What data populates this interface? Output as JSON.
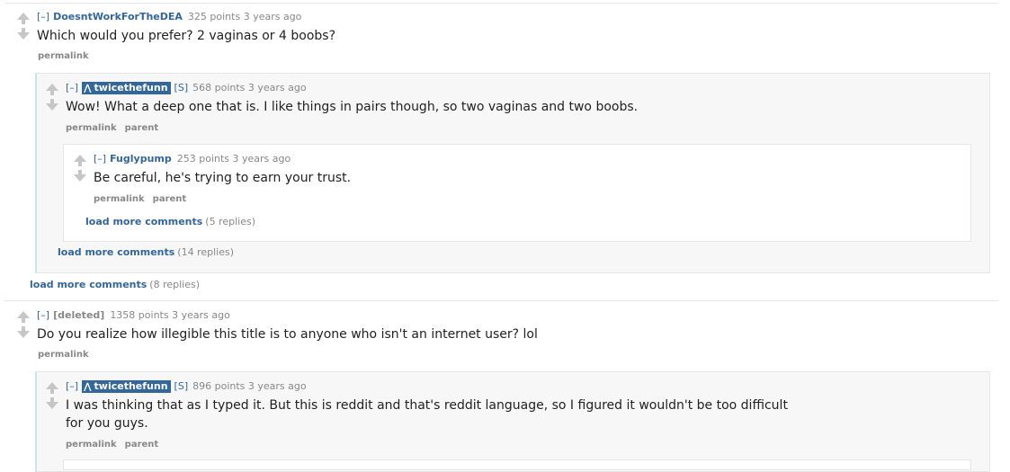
{
  "top_comment_1": {
    "toggle": "[–]",
    "author": "DoesntWorkForTheDEA",
    "meta": "325 points 3 years ago",
    "body": "Which would you prefer? 2 vaginas or 4 boobs?",
    "permalink": "permalink"
  },
  "reply_1": {
    "toggle": "[–]",
    "author": "twicethefunn",
    "submitter": "[S]",
    "meta": "568 points 3 years ago",
    "body": "Wow! What a deep one that is. I like things in pairs though, so two vaginas and two boobs.",
    "permalink": "permalink",
    "parent": "parent"
  },
  "reply_1_1": {
    "toggle": "[–]",
    "author": "Fuglypump",
    "meta": "253 points 3 years ago",
    "body": "Be careful, he's trying to earn your trust.",
    "permalink": "permalink",
    "parent": "parent",
    "more_label": "load more comments",
    "more_count": "(5 replies)"
  },
  "reply_1_more": {
    "label": "load more comments",
    "count": "(14 replies)"
  },
  "top_1_more": {
    "label": "load more comments",
    "count": "(8 replies)"
  },
  "top_comment_2": {
    "toggle": "[–]",
    "author": "[deleted]",
    "meta": "1358 points 3 years ago",
    "body": "Do you realize how illegible this title is to anyone who isn't an internet user? lol",
    "permalink": "permalink"
  },
  "reply_2": {
    "toggle": "[–]",
    "author": "twicethefunn",
    "submitter": "[S]",
    "meta": "896 points 3 years ago",
    "body_line1": "I was thinking that as I typed it. But this is reddit and that's reddit language, so I figured it wouldn't be too difficult",
    "body_line2": "for you guys.",
    "permalink": "permalink",
    "parent": "parent"
  },
  "colors": {
    "link": "#336699",
    "muted": "#888888",
    "op_badge": "#336699",
    "box_bg": "#f7f7f8"
  },
  "icons": {
    "upvote": "arrow-up",
    "downvote": "arrow-down",
    "op": "alien-a-icon"
  }
}
